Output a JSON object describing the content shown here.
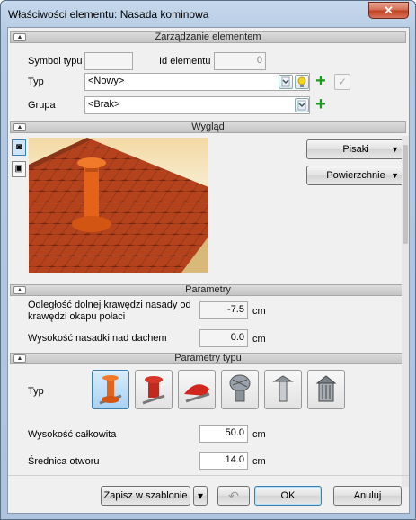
{
  "window": {
    "title": "Właściwości elementu: Nasada kominowa",
    "close": "✕"
  },
  "sections": {
    "management": "Zarządzanie elementem",
    "appearance": "Wygląd",
    "parameters": "Parametry",
    "type_parameters": "Parametry typu"
  },
  "management": {
    "type_symbol_label": "Symbol typu",
    "type_symbol_value": "",
    "element_id_label": "Id elementu",
    "element_id_value": "0",
    "type_label": "Typ",
    "type_value": "<Nowy>",
    "group_label": "Grupa",
    "group_value": "<Brak>"
  },
  "appearance": {
    "pens_button": "Pisaki",
    "surfaces_button": "Powierzchnie"
  },
  "parameters": {
    "distance_label_line1": "Odległość dolnej krawędzi nasady od",
    "distance_label_line2": "krawędzi okapu połaci",
    "distance_value": "-7.5",
    "distance_unit": "cm",
    "height_label": "Wysokość nasadki nad dachem",
    "height_value": "0.0",
    "height_unit": "cm"
  },
  "type_parameters": {
    "type_label": "Typ",
    "type_options": [
      "chimney-cap-type-1",
      "chimney-cap-type-2",
      "chimney-cap-type-3",
      "chimney-cap-type-4",
      "chimney-cap-type-5",
      "chimney-cap-type-6"
    ],
    "selected_index": 0,
    "total_height_label": "Wysokość całkowita",
    "total_height_value": "50.0",
    "total_height_unit": "cm",
    "diameter_label": "Średnica otworu",
    "diameter_value": "14.0",
    "diameter_unit": "cm"
  },
  "footer": {
    "save_template": "Zapisz w szablonie",
    "dropdown_arrow": "▾",
    "undo": "↶",
    "ok": "OK",
    "cancel": "Anuluj"
  },
  "colors": {
    "accent": "#3c7fb1",
    "roof_tile": "#c0441e",
    "cap_orange": "#e5621b",
    "add_green": "#1a9a1a"
  }
}
